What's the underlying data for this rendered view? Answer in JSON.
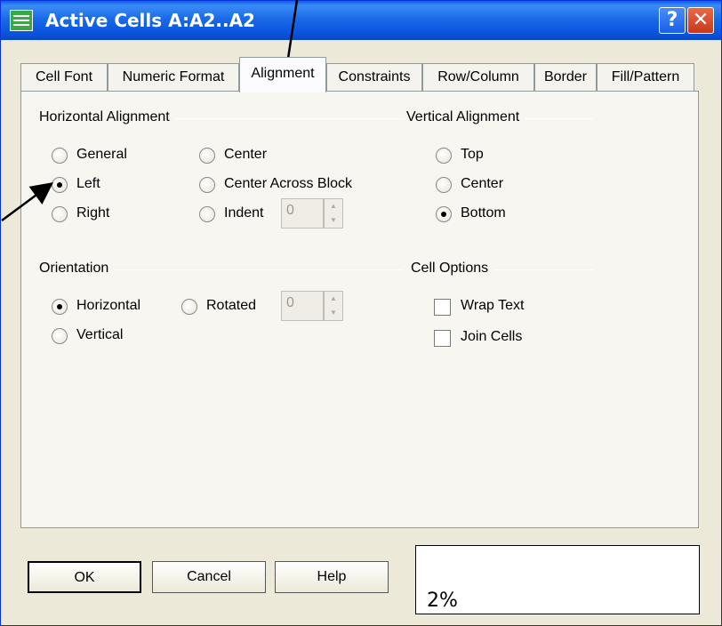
{
  "window": {
    "title": "Active Cells  A:A2..A2",
    "help_glyph": "?",
    "close_glyph": "✕"
  },
  "tabs": [
    {
      "label": "Cell Font",
      "active": false
    },
    {
      "label": "Numeric Format",
      "active": false
    },
    {
      "label": "Alignment",
      "active": true
    },
    {
      "label": "Constraints",
      "active": false
    },
    {
      "label": "Row/Column",
      "active": false
    },
    {
      "label": "Border",
      "active": false
    },
    {
      "label": "Fill/Pattern",
      "active": false
    }
  ],
  "horizontal_alignment": {
    "label": "Horizontal Alignment",
    "options": [
      "General",
      "Left",
      "Right",
      "Center",
      "Center Across Block",
      "Indent"
    ],
    "selected": "Left",
    "indent_value": "0"
  },
  "vertical_alignment": {
    "label": "Vertical Alignment",
    "options": [
      "Top",
      "Center",
      "Bottom"
    ],
    "selected": "Bottom"
  },
  "orientation": {
    "label": "Orientation",
    "options": [
      "Horizontal",
      "Vertical",
      "Rotated"
    ],
    "selected": "Horizontal",
    "rotated_value": "0"
  },
  "cell_options": {
    "label": "Cell Options",
    "wrap_text": {
      "label": "Wrap Text",
      "checked": false
    },
    "join_cells": {
      "label": "Join Cells",
      "checked": false
    }
  },
  "buttons": {
    "ok": "OK",
    "cancel": "Cancel",
    "help": "Help"
  },
  "status": {
    "text": "2%"
  },
  "colors": {
    "titlebar": "#0a5ee8",
    "dialog_bg": "#ece9d8",
    "panel_bg": "#f7f6f0"
  }
}
